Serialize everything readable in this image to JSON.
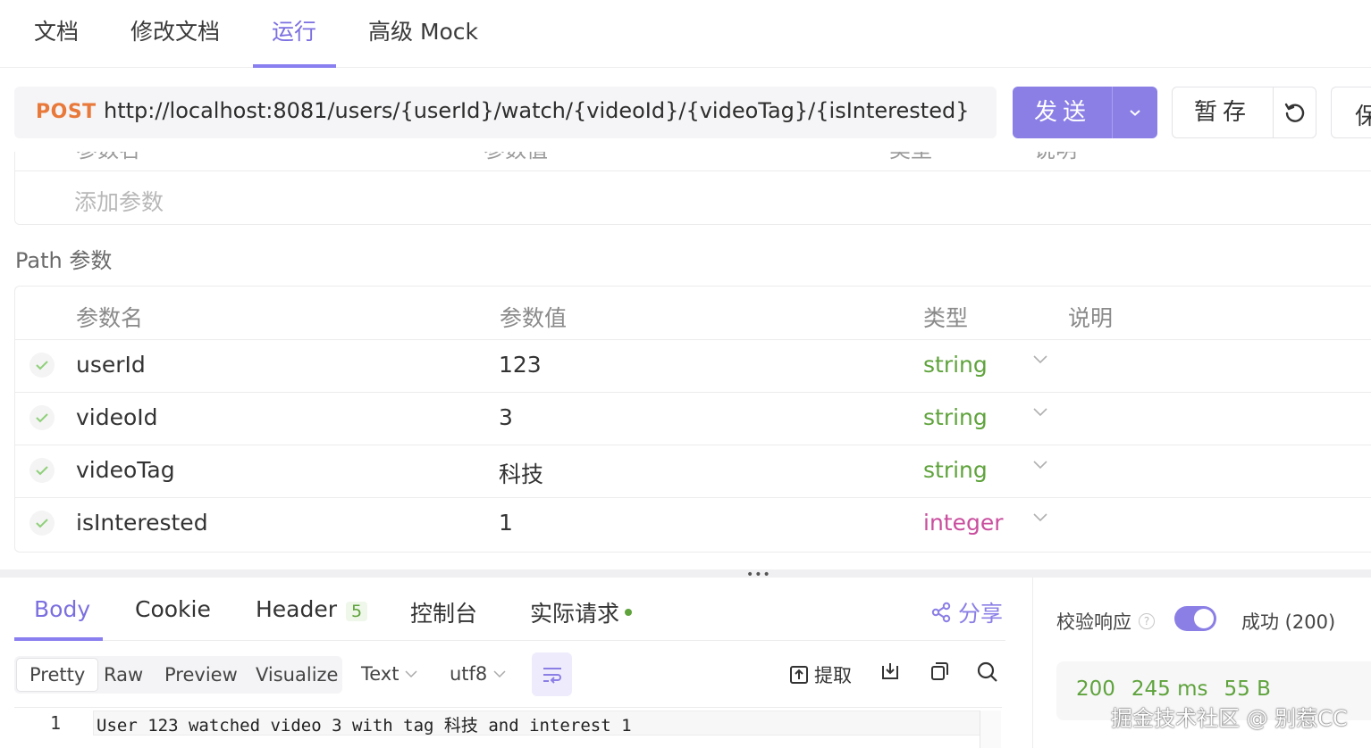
{
  "top_tabs": [
    {
      "label": "文档"
    },
    {
      "label": "修改文档"
    },
    {
      "label": "运行"
    },
    {
      "label": "高级 Mock"
    }
  ],
  "request": {
    "method": "POST",
    "url": "http://localhost:8081/users/{userId}/watch/{videoId}/{videoTag}/{isInterested}",
    "send_label": "发送",
    "save_label": "暂存",
    "more_label": "保"
  },
  "query_params": {
    "columns": [
      "参数名",
      "参数值",
      "类型",
      "说明"
    ],
    "add_placeholder": "添加参数"
  },
  "path_params": {
    "title": "Path 参数",
    "columns": [
      "参数名",
      "参数值",
      "类型",
      "说明"
    ],
    "rows": [
      {
        "name": "userId",
        "value": "123",
        "type": "string"
      },
      {
        "name": "videoId",
        "value": "3",
        "type": "string"
      },
      {
        "name": "videoTag",
        "value": "科技",
        "type": "string"
      },
      {
        "name": "isInterested",
        "value": "1",
        "type": "integer"
      }
    ]
  },
  "response": {
    "tabs": [
      {
        "label": "Body"
      },
      {
        "label": "Cookie"
      },
      {
        "label": "Header",
        "badge": "5"
      },
      {
        "label": "控制台"
      },
      {
        "label": "实际请求"
      }
    ],
    "share_label": "分享",
    "formats": [
      "Pretty",
      "Raw",
      "Preview",
      "Visualize"
    ],
    "content_type": "Text",
    "encoding": "utf8",
    "extract_label": "提取",
    "line_number": "1",
    "body_text": "User 123 watched video 3 with tag 科技 and interest 1"
  },
  "validation": {
    "label": "校验响应",
    "enabled": true,
    "result": "成功 (200)",
    "status": "200",
    "time": "245 ms",
    "size": "55 B"
  },
  "watermark": "掘金技术社区 @ 别惹CC",
  "colors": {
    "accent": "#8b7fe6",
    "method_post": "#e8793a",
    "type_string": "#5fa33c",
    "type_integer": "#c94e9e"
  }
}
